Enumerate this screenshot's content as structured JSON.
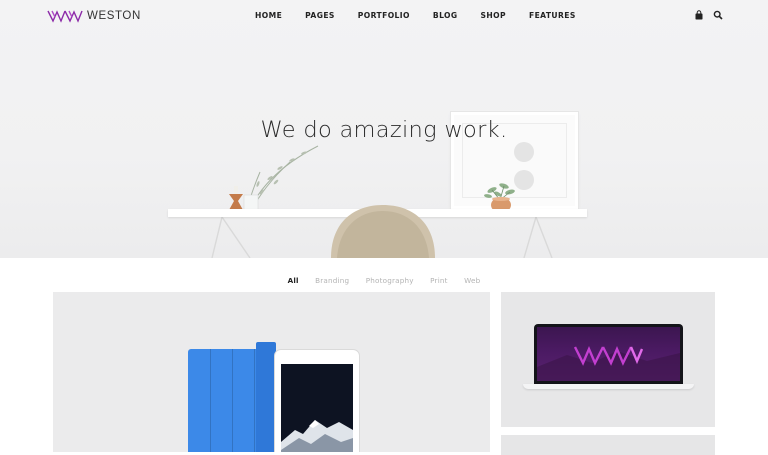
{
  "brand": {
    "name": "WESTON",
    "accent": "#8c2ba8"
  },
  "nav": {
    "items": [
      {
        "label": "HOME"
      },
      {
        "label": "PAGES"
      },
      {
        "label": "PORTFOLIO"
      },
      {
        "label": "BLOG"
      },
      {
        "label": "SHOP"
      },
      {
        "label": "FEATURES"
      }
    ],
    "icons": [
      "shopping-bag-icon",
      "search-icon"
    ]
  },
  "hero": {
    "title": "We do amazing work."
  },
  "filters": {
    "items": [
      {
        "label": "All",
        "active": true
      },
      {
        "label": "Branding",
        "active": false
      },
      {
        "label": "Photography",
        "active": false
      },
      {
        "label": "Print",
        "active": false
      },
      {
        "label": "Web",
        "active": false
      }
    ]
  },
  "portfolio": {
    "items": [
      {
        "type": "tablet-mockup",
        "cover_color": "#3c89e8"
      },
      {
        "type": "laptop-mockup",
        "screen_color": "#4b1a63"
      },
      {
        "type": "partial-card"
      }
    ]
  }
}
